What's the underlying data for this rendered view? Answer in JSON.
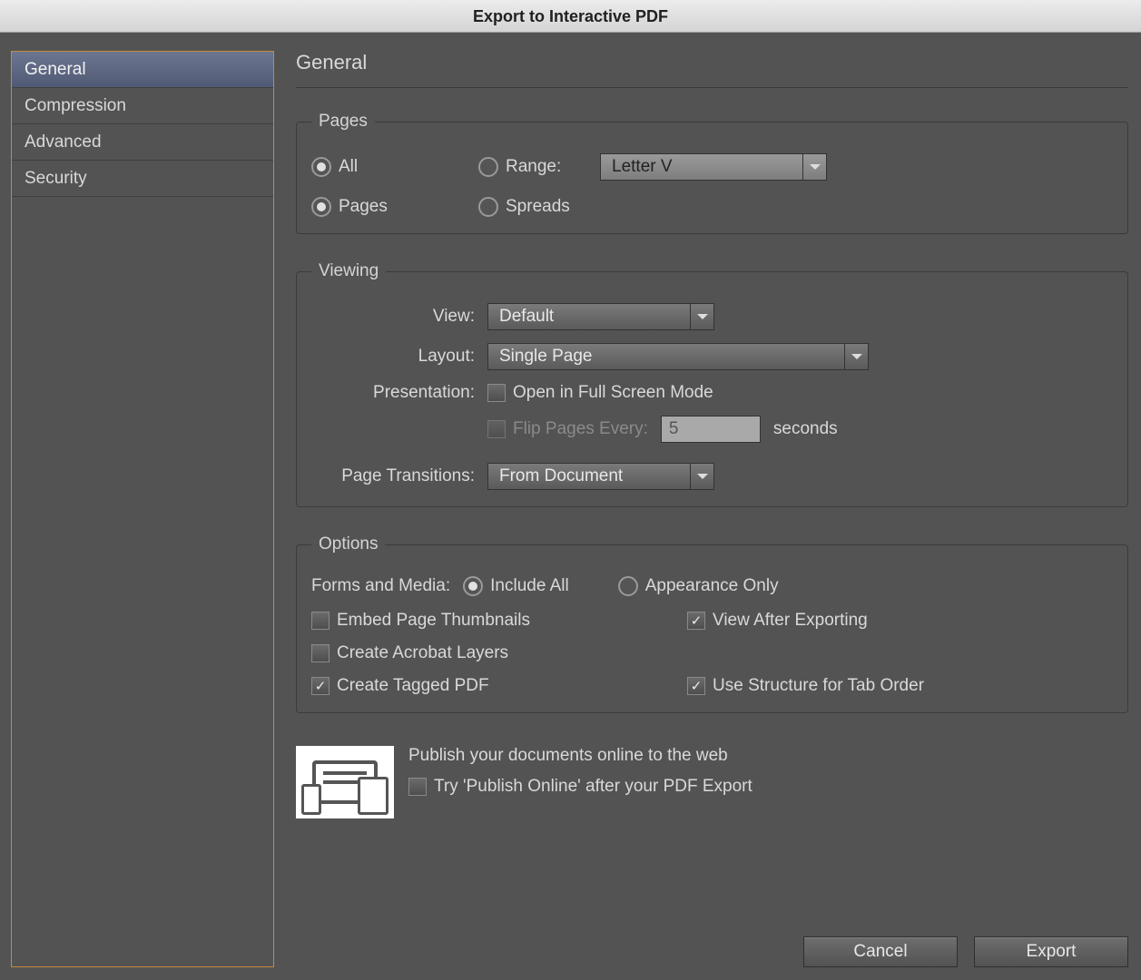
{
  "window": {
    "title": "Export to Interactive PDF"
  },
  "sidebar": {
    "items": [
      {
        "label": "General",
        "selected": true
      },
      {
        "label": "Compression",
        "selected": false
      },
      {
        "label": "Advanced",
        "selected": false
      },
      {
        "label": "Security",
        "selected": false
      }
    ]
  },
  "main": {
    "title": "General",
    "pages": {
      "legend": "Pages",
      "all_label": "All",
      "range_label": "Range:",
      "range_value": "Letter V",
      "pages_label": "Pages",
      "spreads_label": "Spreads",
      "scope_selected": "all",
      "layout_selected": "pages"
    },
    "viewing": {
      "legend": "Viewing",
      "view_label": "View:",
      "view_value": "Default",
      "layout_label": "Layout:",
      "layout_value": "Single Page",
      "presentation_label": "Presentation:",
      "fullscreen_label": "Open in Full Screen Mode",
      "fullscreen_checked": false,
      "flip_label": "Flip Pages Every:",
      "flip_value": "5",
      "seconds_label": "seconds",
      "flip_enabled": false,
      "transitions_label": "Page Transitions:",
      "transitions_value": "From Document"
    },
    "options": {
      "legend": "Options",
      "forms_label": "Forms and Media:",
      "include_all_label": "Include All",
      "appearance_only_label": "Appearance Only",
      "forms_selected": "include_all",
      "embed_thumbs": {
        "label": "Embed Page Thumbnails",
        "checked": false
      },
      "view_after": {
        "label": "View After Exporting",
        "checked": true
      },
      "acrobat_layers": {
        "label": "Create Acrobat Layers",
        "checked": false
      },
      "tagged_pdf": {
        "label": "Create Tagged PDF",
        "checked": true
      },
      "tab_order": {
        "label": "Use Structure for Tab Order",
        "checked": true
      }
    },
    "promo": {
      "headline": "Publish your documents online to the web",
      "checkbox_label": "Try 'Publish Online' after your PDF Export",
      "checked": false
    }
  },
  "buttons": {
    "cancel": "Cancel",
    "export": "Export"
  }
}
